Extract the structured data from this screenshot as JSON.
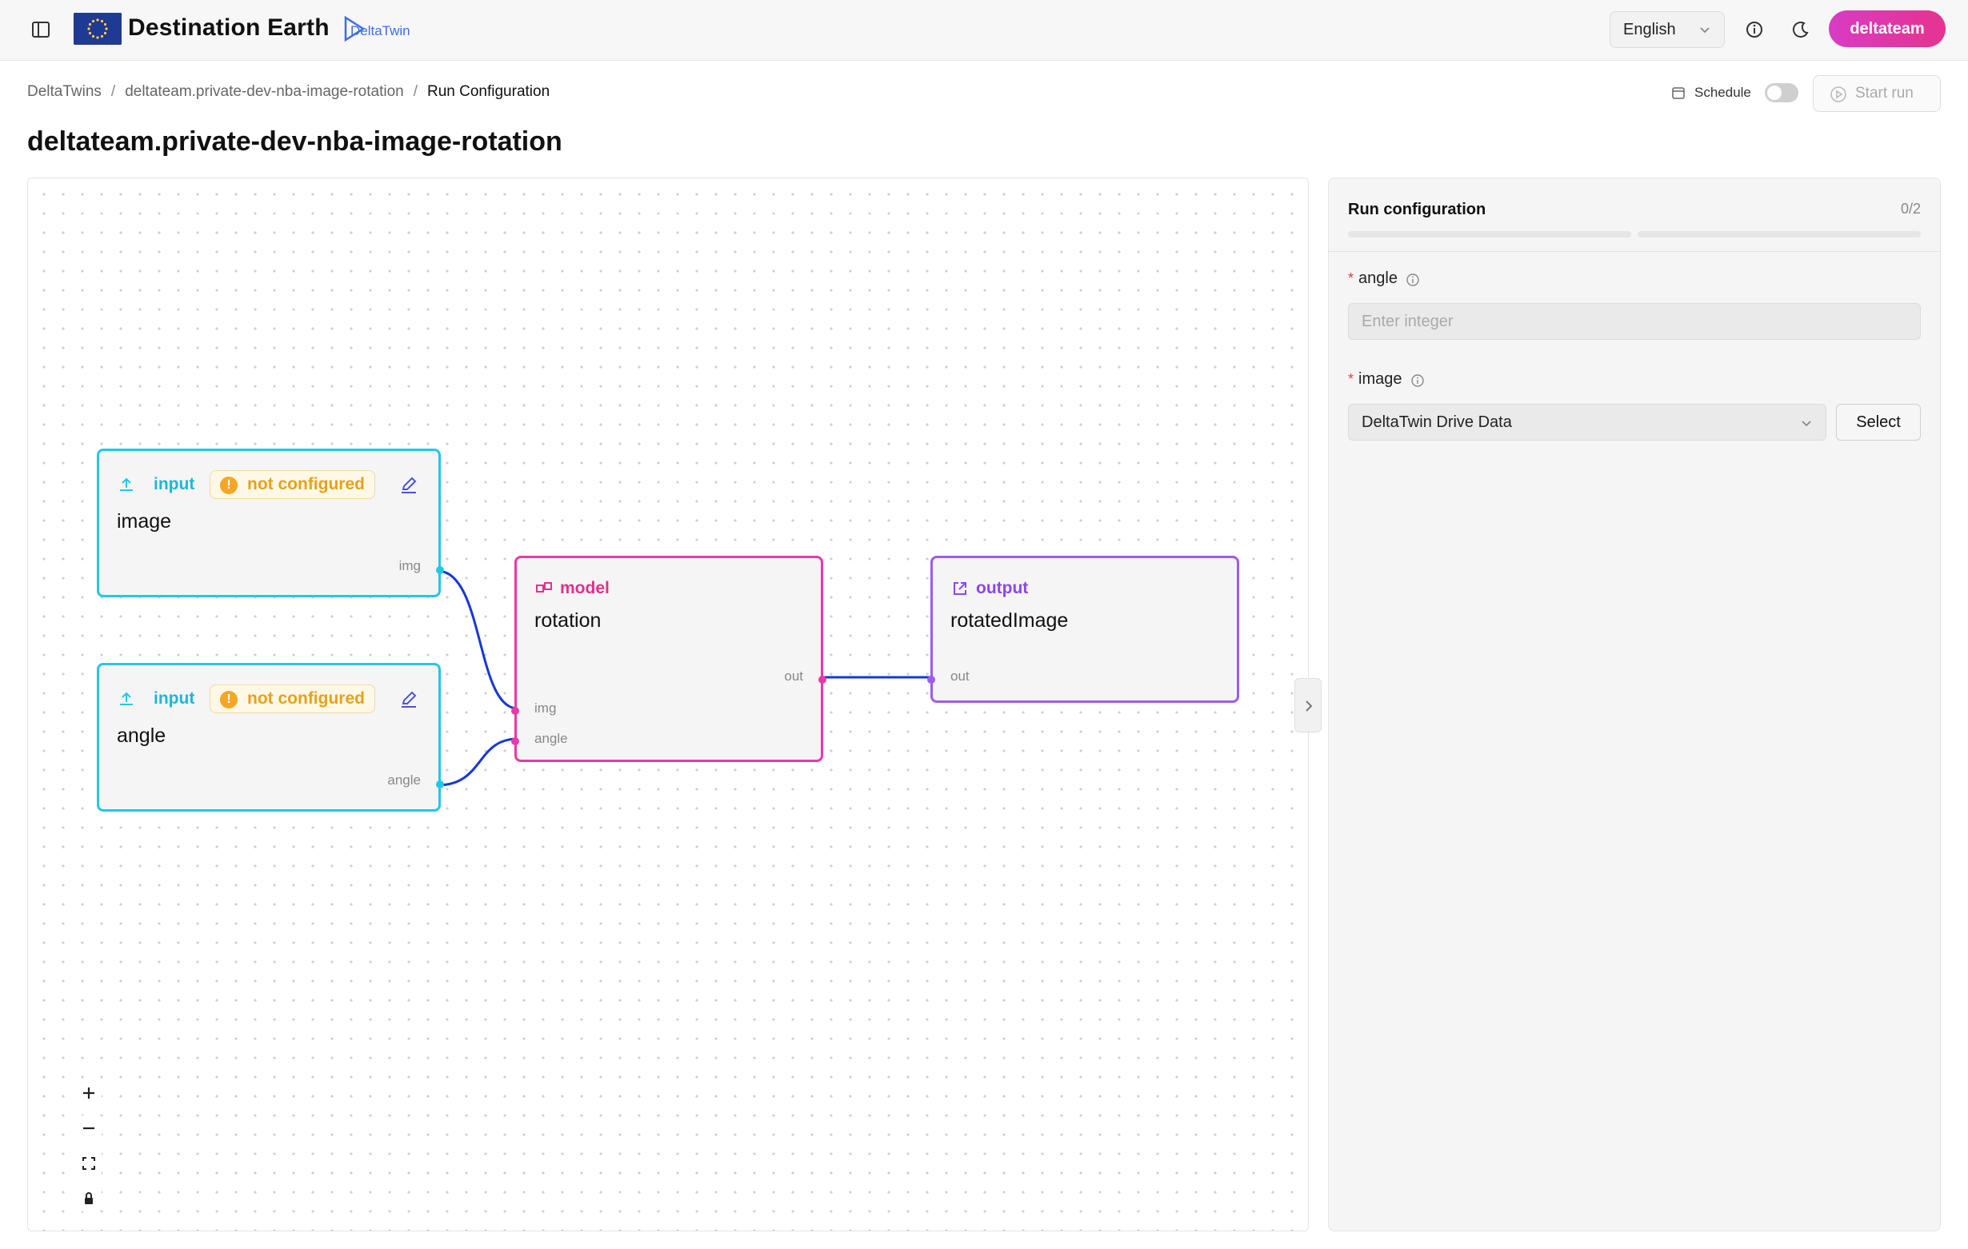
{
  "header": {
    "app_title": "Destination Earth",
    "logo_text": "DeltaTwin",
    "language": "English",
    "user": "deltateam"
  },
  "breadcrumb": {
    "items": [
      "DeltaTwins",
      "deltateam.private-dev-nba-image-rotation",
      "Run Configuration"
    ],
    "separator": "/"
  },
  "toolbar": {
    "schedule_label": "Schedule",
    "schedule_enabled": false,
    "start_run_label": "Start run"
  },
  "page": {
    "title": "deltateam.private-dev-nba-image-rotation"
  },
  "graph": {
    "nodes": [
      {
        "id": "image",
        "type": "input",
        "title": "image",
        "status": "not configured",
        "ports": [
          "img"
        ]
      },
      {
        "id": "angle",
        "type": "input",
        "title": "angle",
        "status": "not configured",
        "ports": [
          "angle"
        ]
      },
      {
        "id": "rotation",
        "type": "model",
        "title": "rotation",
        "in_ports": [
          "img",
          "angle"
        ],
        "out_ports": [
          "out"
        ]
      },
      {
        "id": "rotatedImage",
        "type": "output",
        "title": "rotatedImage",
        "in_ports": [
          "out"
        ]
      }
    ]
  },
  "panel": {
    "title": "Run configuration",
    "progress_count": "0/2",
    "progress_completed": 0,
    "progress_total": 2,
    "fields": [
      {
        "label": "angle",
        "required_mark": "*",
        "placeholder": "Enter integer",
        "value": ""
      },
      {
        "label": "image",
        "required_mark": "*",
        "selected": "DeltaTwin Drive Data",
        "button_label": "Select"
      }
    ]
  },
  "colors": {
    "input": "#22c8e8",
    "model": "#e83aa6",
    "output": "#9b5cf2",
    "edge": "#1737d6",
    "warning": "#f5a623",
    "accent": "#e6338f"
  }
}
